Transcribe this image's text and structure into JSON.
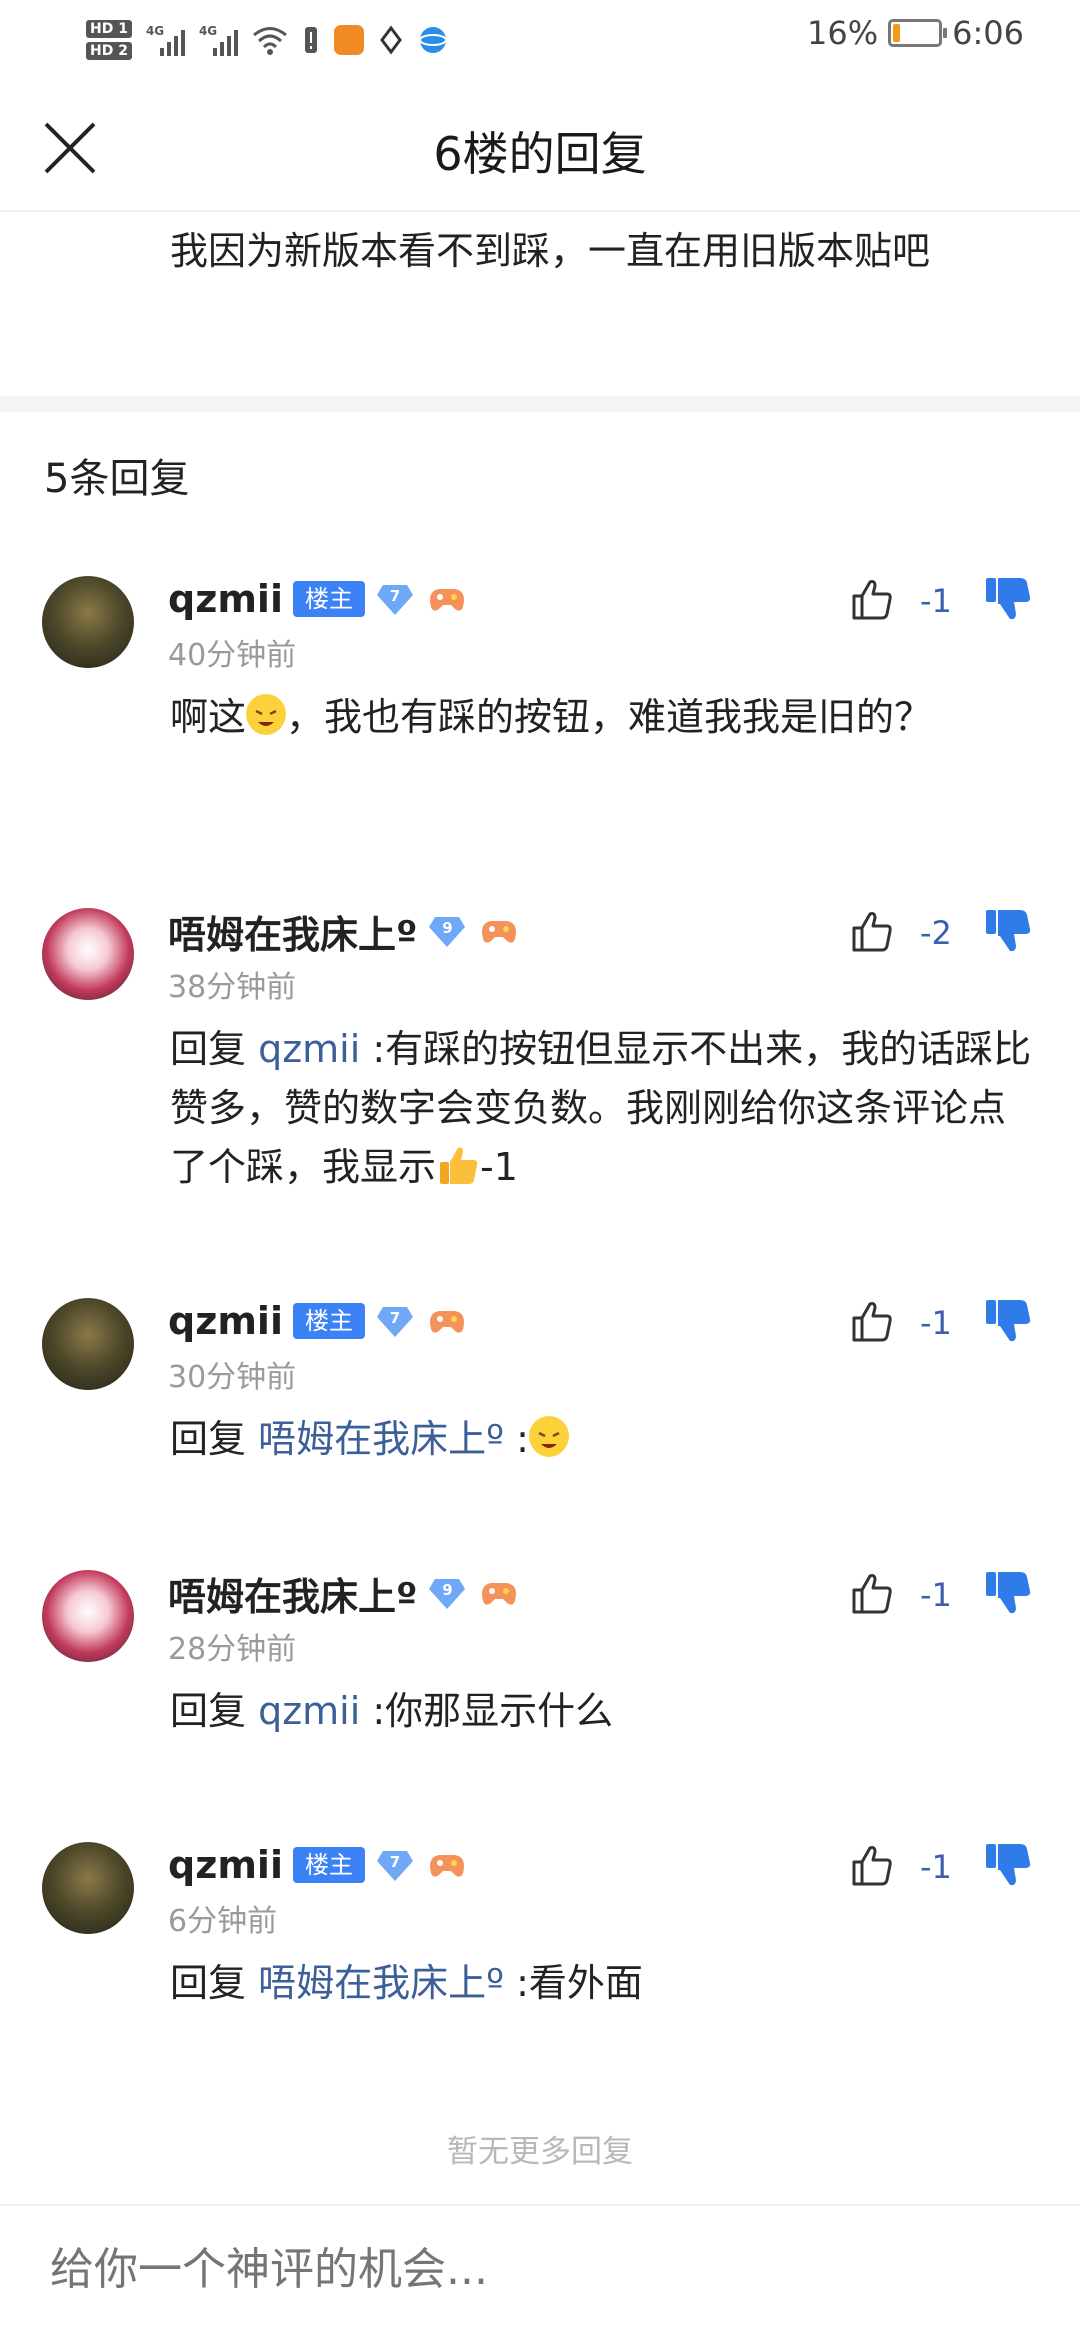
{
  "status_bar": {
    "hd1": "HD 1",
    "hd2": "HD 2",
    "sig1_label": "4G",
    "sig2_label": "4G",
    "battery_percent": "16%",
    "battery_level": 0.16,
    "time": "6:06"
  },
  "header": {
    "title": "6楼的回复"
  },
  "original_post": {
    "text": "我因为新版本看不到踩，一直在用旧版本贴吧"
  },
  "reply_count": "5条回复",
  "replies": [
    {
      "username": "qzmii",
      "owner_badge": "楼主",
      "level": "7",
      "time": "40分钟前",
      "like_count": "-1",
      "prefix": "啊这",
      "mention": "",
      "body": "，我也有踩的按钮，难道我我是旧的？"
    },
    {
      "username": "唔姆在我床上º",
      "owner_badge": "",
      "level": "9",
      "time": "38分钟前",
      "like_count": "-2",
      "prefix": "回复 ",
      "mention": "qzmii",
      "body": " :有踩的按钮但显示不出来，我的话踩比赞多，赞的数字会变负数。我刚刚给你这条评论点了个踩，我显示",
      "suffix": "-1"
    },
    {
      "username": "qzmii",
      "owner_badge": "楼主",
      "level": "7",
      "time": "30分钟前",
      "like_count": "-1",
      "prefix": "回复 ",
      "mention": "唔姆在我床上º",
      "body": " :"
    },
    {
      "username": "唔姆在我床上º",
      "owner_badge": "",
      "level": "9",
      "time": "28分钟前",
      "like_count": "-1",
      "prefix": "回复 ",
      "mention": "qzmii",
      "body": " :你那显示什么"
    },
    {
      "username": "qzmii",
      "owner_badge": "楼主",
      "level": "7",
      "time": "6分钟前",
      "like_count": "-1",
      "prefix": "回复 ",
      "mention": "唔姆在我床上º",
      "body": " :看外面"
    }
  ],
  "no_more": "暂无更多回复",
  "comment_input": {
    "placeholder": "给你一个神评的机会..."
  },
  "colors": {
    "accent": "#3b82f6",
    "mention": "#3d5f98",
    "like_count": "#3b5fb0",
    "dislike": "#2f7be8",
    "battery": "#f39a1a"
  },
  "icons": [
    "close-icon",
    "like-icon",
    "dislike-icon",
    "diamond-level-icon",
    "game-controller-icon",
    "wifi-icon",
    "battery-icon",
    "signal-icon"
  ]
}
